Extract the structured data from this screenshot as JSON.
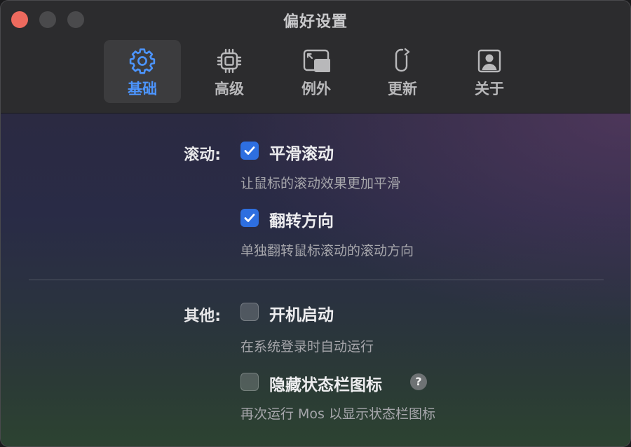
{
  "window": {
    "title": "偏好设置"
  },
  "toolbar": {
    "tabs": [
      {
        "label": "基础",
        "icon": "gear-icon",
        "active": true
      },
      {
        "label": "高级",
        "icon": "cpu-chip-icon",
        "active": false
      },
      {
        "label": "例外",
        "icon": "window-exception-icon",
        "active": false
      },
      {
        "label": "更新",
        "icon": "mouse-refresh-icon",
        "active": false
      },
      {
        "label": "关于",
        "icon": "person-card-icon",
        "active": false
      }
    ]
  },
  "scroll_section": {
    "label": "滚动:",
    "smooth": {
      "label": "平滑滚动",
      "checked": true,
      "description": "让鼠标的滚动效果更加平滑"
    },
    "reverse": {
      "label": "翻转方向",
      "checked": true,
      "description": "单独翻转鼠标滚动的滚动方向"
    }
  },
  "other_section": {
    "label": "其他:",
    "launch_at_login": {
      "label": "开机启动",
      "checked": false,
      "description": "在系统登录时自动运行"
    },
    "hide_status_icon": {
      "label": "隐藏状态栏图标",
      "checked": false,
      "help": "?",
      "description": "再次运行 Mos 以显示状态栏图标"
    }
  },
  "colors": {
    "accent": "#4c95ff",
    "checkbox_on": "#2e6fe0",
    "close_button": "#ed6a5e"
  }
}
